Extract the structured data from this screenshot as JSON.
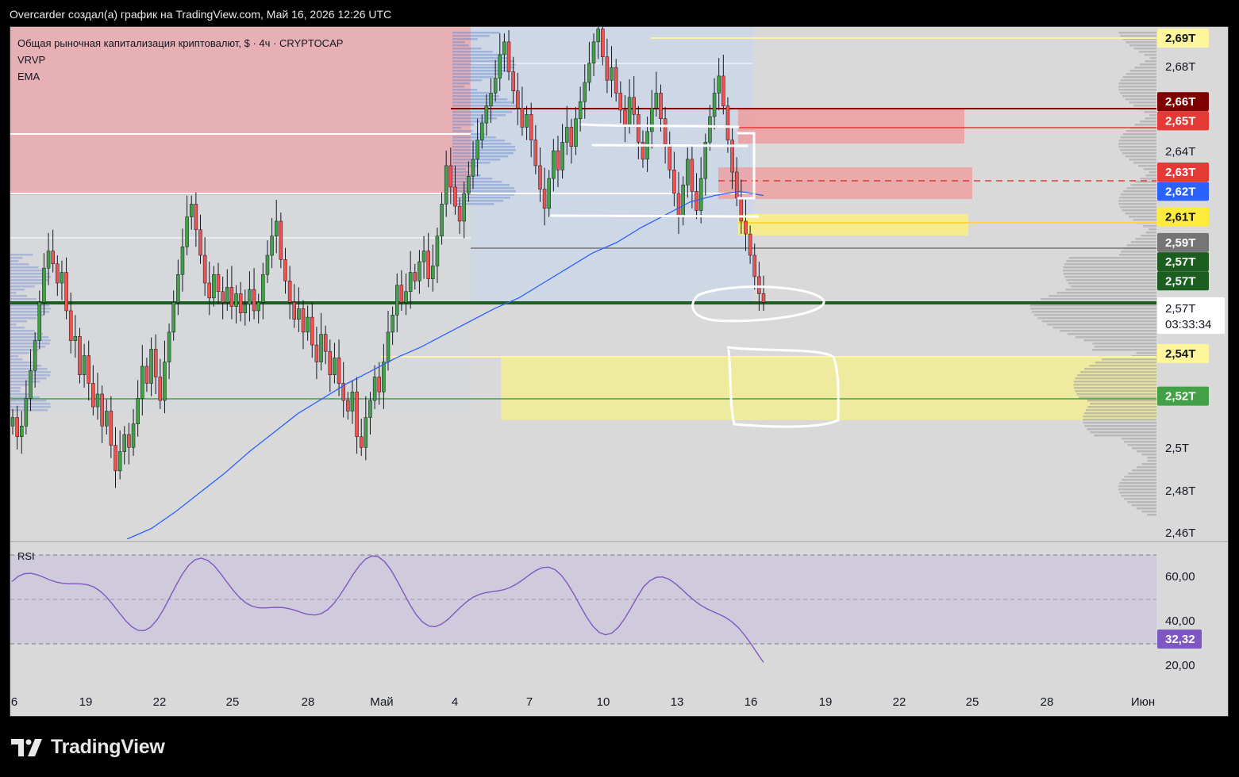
{
  "header": {
    "caption": "Overcarder создал(а) график на TradingView.com, Май 16, 2026 12:26 UTC"
  },
  "legend": {
    "symbol": "Общая рыночная капитализация криптовалют, $ · 4ч · CRYPTOCAP",
    "indicator1": "VRVP",
    "indicator2": "EMA"
  },
  "rsi_label": "RSI",
  "logo_text": "TradingView",
  "colors": {
    "up": "#26a69a",
    "up_candle": "#43a047",
    "down": "#ef5350",
    "ema": "#2962ff",
    "rsi": "#7e57c2"
  },
  "chart_data": [
    {
      "type": "candlestick",
      "title": "Общая рыночная капитализация криптовалют, $ · 4ч · CRYPTOCAP",
      "unit": "T",
      "x_ticks": [
        "6",
        "19",
        "22",
        "25",
        "28",
        "Май",
        "4",
        "7",
        "10",
        "13",
        "16",
        "19",
        "22",
        "25",
        "28",
        "Июн"
      ],
      "y_ticks": [
        "2,68T",
        "2,64T",
        "2,5T",
        "2,48T",
        "2,46T"
      ],
      "ylim": [
        2.455,
        2.695
      ],
      "price_badges": [
        {
          "label": "2,69T",
          "value": 2.69,
          "bg": "#fff59d",
          "fg": "#131722"
        },
        {
          "label": "2,66T",
          "value": 2.66,
          "bg": "#7f0000",
          "fg": "#ffffff"
        },
        {
          "label": "2,65T",
          "value": 2.651,
          "bg": "#e53935",
          "fg": "#ffffff"
        },
        {
          "label": "2,63T",
          "value": 2.627,
          "bg": "#e53935",
          "fg": "#ffffff"
        },
        {
          "label": "2,62T",
          "value": 2.618,
          "bg": "#2962ff",
          "fg": "#ffffff"
        },
        {
          "label": "2,61T",
          "value": 2.606,
          "bg": "#ffeb3b",
          "fg": "#131722"
        },
        {
          "label": "2,59T",
          "value": 2.594,
          "bg": "#757575",
          "fg": "#ffffff"
        },
        {
          "label": "2,57T",
          "value": 2.585,
          "bg": "#1b5e20",
          "fg": "#ffffff"
        },
        {
          "label": "2,57T",
          "value": 2.576,
          "bg": "#1b5e20",
          "fg": "#ffffff"
        },
        {
          "label": "2,54T",
          "value": 2.542,
          "bg": "#fff59d",
          "fg": "#131722"
        },
        {
          "label": "2,52T",
          "value": 2.522,
          "bg": "#43a047",
          "fg": "#ffffff"
        }
      ],
      "last_price": {
        "label": "2,57T",
        "countdown": "03:33:34",
        "value": 2.566
      },
      "closes": [
        2.512,
        2.503,
        2.508,
        2.521,
        2.534,
        2.548,
        2.566,
        2.582,
        2.59,
        2.584,
        2.575,
        2.58,
        2.562,
        2.548,
        2.55,
        2.532,
        2.541,
        2.528,
        2.517,
        2.523,
        2.508,
        2.515,
        2.499,
        2.487,
        2.496,
        2.504,
        2.498,
        2.509,
        2.521,
        2.536,
        2.528,
        2.544,
        2.531,
        2.52,
        2.538,
        2.552,
        2.566,
        2.579,
        2.592,
        2.606,
        2.612,
        2.6,
        2.588,
        2.575,
        2.568,
        2.579,
        2.571,
        2.566,
        2.573,
        2.564,
        2.57,
        2.561,
        2.565,
        2.572,
        2.562,
        2.566,
        2.579,
        2.588,
        2.597,
        2.604,
        2.586,
        2.576,
        2.566,
        2.558,
        2.563,
        2.552,
        2.559,
        2.546,
        2.538,
        2.551,
        2.543,
        2.532,
        2.54,
        2.528,
        2.52,
        2.515,
        2.524,
        2.503,
        2.498,
        2.512,
        2.52,
        2.531,
        2.524,
        2.538,
        2.552,
        2.56,
        2.574,
        2.566,
        2.571,
        2.58,
        2.576,
        2.585,
        2.59,
        2.577,
        2.583,
        2.597,
        2.612,
        2.63,
        2.62,
        2.611,
        2.604,
        2.617,
        2.625,
        2.633,
        2.642,
        2.65,
        2.658,
        2.664,
        2.671,
        2.682,
        2.688,
        2.674,
        2.665,
        2.657,
        2.648,
        2.654,
        2.642,
        2.63,
        2.619,
        2.61,
        2.624,
        2.637,
        2.628,
        2.641,
        2.648,
        2.639,
        2.652,
        2.66,
        2.669,
        2.678,
        2.688,
        2.694,
        2.681,
        2.67,
        2.676,
        2.664,
        2.656,
        2.649,
        2.662,
        2.654,
        2.641,
        2.633,
        2.646,
        2.657,
        2.664,
        2.652,
        2.639,
        2.628,
        2.617,
        2.606,
        2.621,
        2.633,
        2.618,
        2.609,
        2.624,
        2.641,
        2.653,
        2.664,
        2.672,
        2.658,
        2.642,
        2.627,
        2.615,
        2.604,
        2.598,
        2.588,
        2.578,
        2.57,
        2.566
      ],
      "ema": [
        2.455,
        2.46,
        2.468,
        2.477,
        2.486,
        2.496,
        2.505,
        2.514,
        2.521,
        2.528,
        2.534,
        2.54,
        2.545,
        2.551,
        2.557,
        2.563,
        2.568,
        2.575,
        2.582,
        2.589,
        2.594,
        2.601,
        2.607,
        2.613,
        2.616,
        2.618,
        2.616
      ],
      "rsi": {
        "value_label": "32,32",
        "y_ticks": [
          "60,00",
          "40,00",
          "20,00"
        ],
        "bands": [
          70,
          30
        ]
      }
    }
  ]
}
